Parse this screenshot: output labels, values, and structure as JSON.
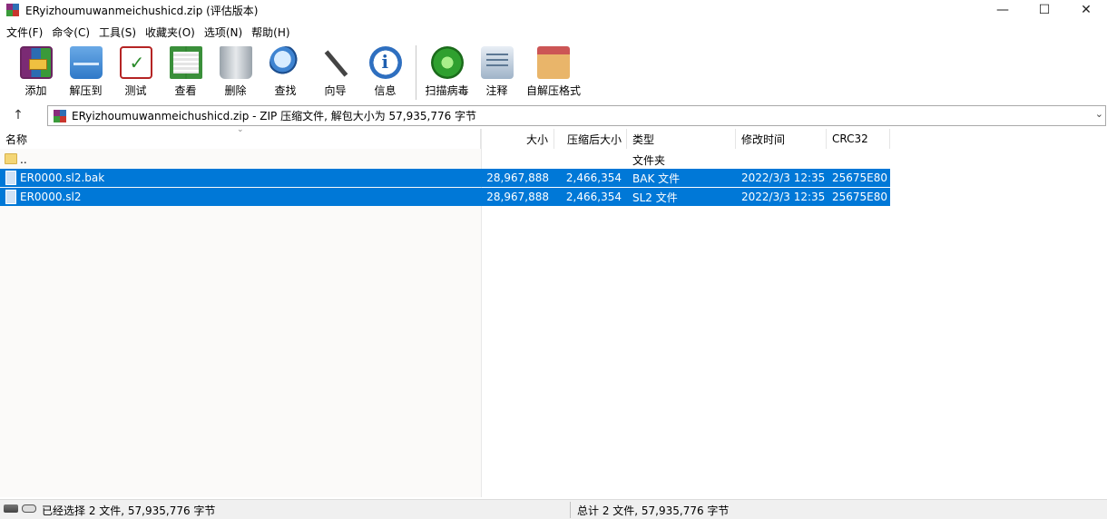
{
  "window": {
    "title": "ERyizhoumuwanmeichushicd.zip (评估版本)",
    "minimize": "—",
    "maximize": "☐",
    "close": "✕"
  },
  "menu": [
    "文件(F)",
    "命令(C)",
    "工具(S)",
    "收藏夹(O)",
    "选项(N)",
    "帮助(H)"
  ],
  "toolbar": [
    {
      "label": "添加",
      "icon": "archive-add-icon"
    },
    {
      "label": "解压到",
      "icon": "folder-extract-icon"
    },
    {
      "label": "测试",
      "icon": "clipboard-check-icon"
    },
    {
      "label": "查看",
      "icon": "book-view-icon"
    },
    {
      "label": "删除",
      "icon": "trash-icon"
    },
    {
      "label": "查找",
      "icon": "magnifier-icon"
    },
    {
      "label": "向导",
      "icon": "magic-wand-icon"
    },
    {
      "label": "信息",
      "icon": "info-icon"
    },
    {
      "label": "扫描病毒",
      "icon": "virus-scan-icon"
    },
    {
      "label": "注释",
      "icon": "comment-icon"
    },
    {
      "label": "自解压格式",
      "icon": "sfx-box-icon"
    }
  ],
  "address": {
    "up": "↑",
    "text": "ERyizhoumuwanmeichushicd.zip - ZIP 压缩文件, 解包大小为 57,935,776 字节",
    "dropdown": "⌄"
  },
  "columns": {
    "name": "名称",
    "size": "大小",
    "packed": "压缩后大小",
    "type": "类型",
    "modified": "修改时间",
    "crc": "CRC32",
    "sort_indicator": "⌄"
  },
  "files": [
    {
      "name": "..",
      "size": "",
      "packed": "",
      "type": "文件夹",
      "modified": "",
      "crc": "",
      "kind": "folder",
      "selected": false
    },
    {
      "name": "ER0000.sl2.bak",
      "size": "28,967,888",
      "packed": "2,466,354",
      "type": "BAK 文件",
      "modified": "2022/3/3 12:35",
      "crc": "25675E80",
      "kind": "file",
      "selected": true
    },
    {
      "name": "ER0000.sl2",
      "size": "28,967,888",
      "packed": "2,466,354",
      "type": "SL2 文件",
      "modified": "2022/3/3 12:35",
      "crc": "25675E80",
      "kind": "file",
      "selected": true
    }
  ],
  "status": {
    "left": "已经选择 2 文件, 57,935,776 字节",
    "right": "总计 2 文件, 57,935,776 字节"
  },
  "colors": {
    "selection": "#0078d7",
    "window_bg": "#ffffff",
    "statusbar_bg": "#f0f0f0"
  }
}
